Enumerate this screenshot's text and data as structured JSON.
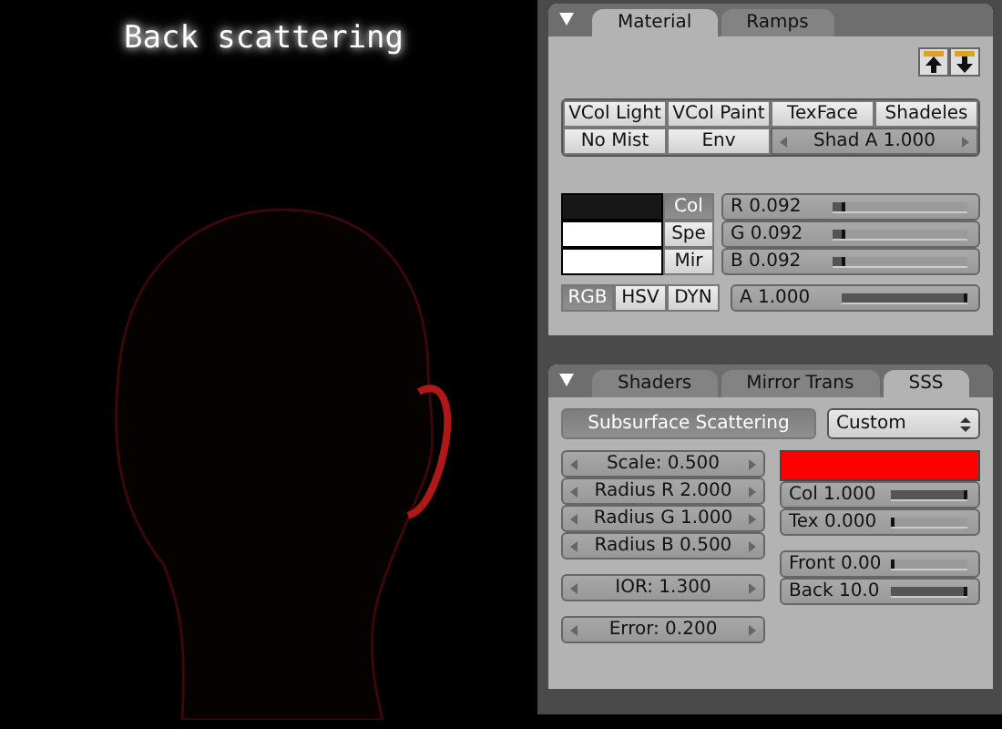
{
  "render": {
    "title": "Back scattering"
  },
  "material_panel": {
    "tabs": [
      {
        "label": "Material",
        "selected": true
      },
      {
        "label": "Ramps",
        "selected": false
      }
    ],
    "toggles": [
      {
        "label": "VCol Light",
        "on": false
      },
      {
        "label": "VCol Paint",
        "on": false
      },
      {
        "label": "TexFace",
        "on": false
      },
      {
        "label": "Shadeles",
        "on": false
      },
      {
        "label": "No Mist",
        "on": false
      },
      {
        "label": "Env",
        "on": false
      }
    ],
    "shad_a": "Shad A 1.000",
    "swatches": [
      {
        "label": "Col",
        "selected": true,
        "color": "#171717"
      },
      {
        "label": "Spe",
        "selected": false,
        "color": "#ffffff"
      },
      {
        "label": "Mir",
        "selected": false,
        "color": "#ffffff"
      }
    ],
    "sliders": [
      {
        "label": "R 0.092",
        "level": 0.092
      },
      {
        "label": "G 0.092",
        "level": 0.092
      },
      {
        "label": "B 0.092",
        "level": 0.092
      }
    ],
    "modes": [
      {
        "label": "RGB",
        "selected": true
      },
      {
        "label": "HSV",
        "selected": false
      },
      {
        "label": "DYN",
        "selected": false
      }
    ],
    "alpha": {
      "label": "A 1.000",
      "level": 1
    }
  },
  "sss_panel": {
    "tabs": [
      {
        "label": "Shaders",
        "selected": false
      },
      {
        "label": "Mirror Trans",
        "selected": false
      },
      {
        "label": "SSS",
        "selected": true
      }
    ],
    "toggle": {
      "label": "Subsurface Scattering",
      "on": true
    },
    "preset": "Custom",
    "fields": [
      {
        "label": "Scale: 0.500"
      },
      {
        "label": "Radius R 2.000"
      },
      {
        "label": "Radius G 1.000"
      },
      {
        "label": "Radius B 0.500"
      }
    ],
    "ior": "IOR: 1.300",
    "error": "Error: 0.200",
    "color": "#ff0000",
    "sliders": [
      {
        "label": "Col 1.000",
        "level": 1
      },
      {
        "label": "Tex 0.000",
        "level": 0
      }
    ],
    "scatter": [
      {
        "label": "Front 0.00",
        "level": 0
      },
      {
        "label": "Back 10.0",
        "level": 1
      }
    ]
  }
}
